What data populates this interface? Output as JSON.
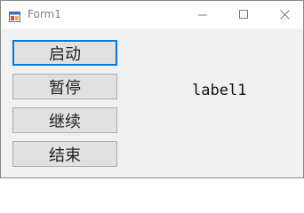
{
  "window": {
    "title": "Form1",
    "icons": {
      "app": "form-app-icon",
      "minimize": "minimize-icon",
      "maximize": "maximize-icon",
      "close": "close-icon"
    }
  },
  "buttons": {
    "start": "启动",
    "pause": "暂停",
    "continue": "继续",
    "end": "结束"
  },
  "label1": "label1",
  "colors": {
    "focus_border": "#0078d7",
    "button_bg": "#e1e1e1",
    "client_bg": "#f0f0f0"
  }
}
